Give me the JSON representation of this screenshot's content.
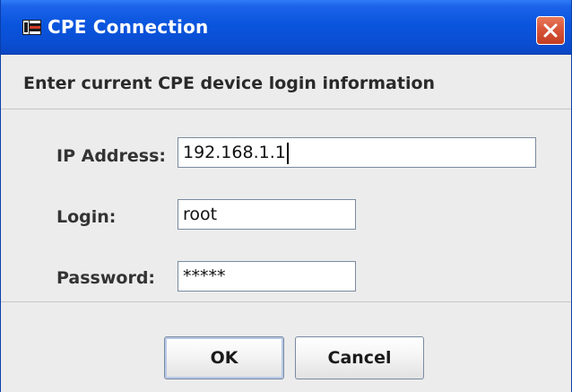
{
  "window": {
    "title": "CPE Connection",
    "app_icon": "app-logo-icon",
    "close_icon": "close-icon",
    "colors": {
      "titlebar": "#0a55de",
      "close_button": "#d8553a",
      "body": "#ececec"
    }
  },
  "header": {
    "text": "Enter current CPE device login information"
  },
  "form": {
    "ip_address": {
      "label": "IP Address:",
      "value": "192.168.1.1"
    },
    "login": {
      "label": "Login:",
      "value": "root"
    },
    "password": {
      "label": "Password:",
      "value": "*****"
    }
  },
  "buttons": {
    "ok_label": "OK",
    "cancel_label": "Cancel"
  }
}
